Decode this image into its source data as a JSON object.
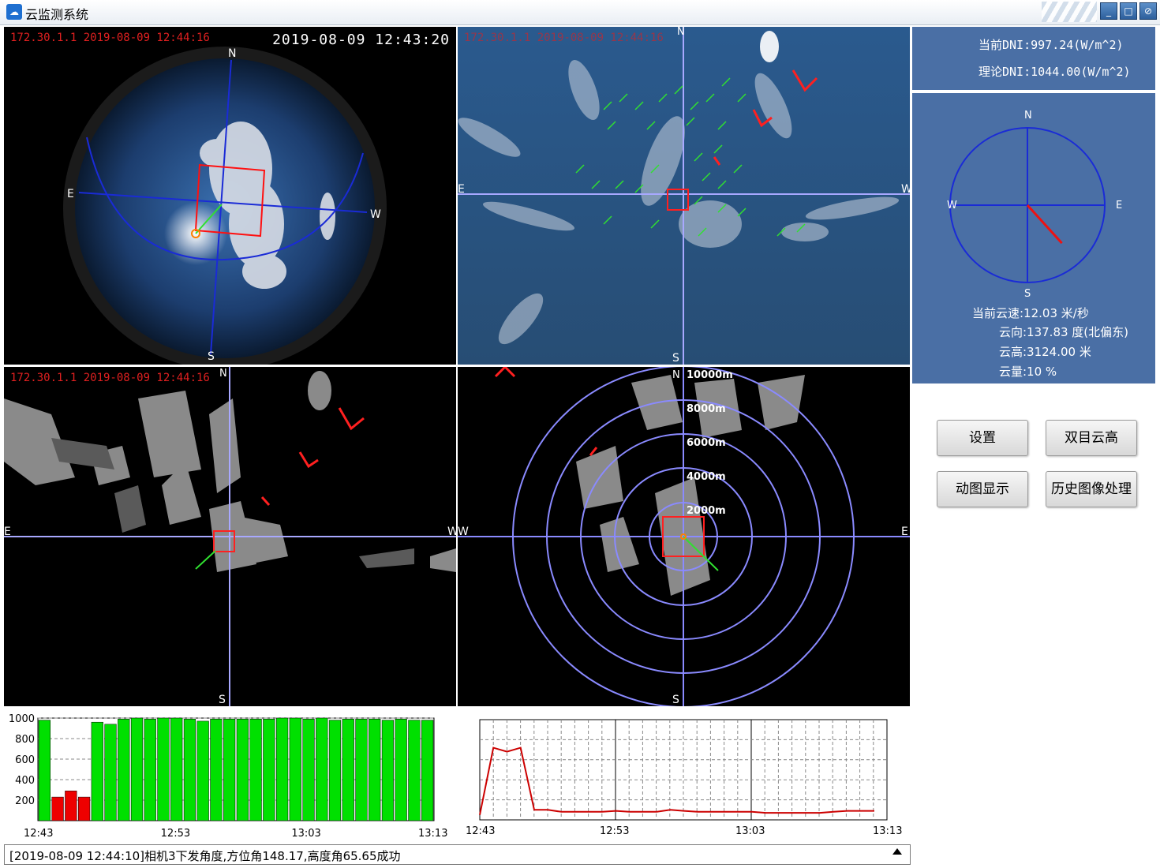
{
  "window": {
    "title": "云监测系统",
    "buttons": [
      "minimize",
      "maximize",
      "close"
    ]
  },
  "panels": {
    "fisheye": {
      "ip_time": "172.30.1.1 2019-08-09 12:44:16",
      "timestamp": "2019-08-09 12:43:20",
      "dirs": {
        "n": "N",
        "s": "S",
        "e": "E",
        "w": "W"
      }
    },
    "projection": {
      "ip_time": "172.30.1.1 2019-08-09 12:44:16",
      "dirs": {
        "n": "N",
        "s": "S",
        "e": "E",
        "w": "W"
      }
    },
    "binary": {
      "ip_time": "172.30.1.1 2019-08-09 12:44:16",
      "dirs": {
        "n": "N",
        "s": "S",
        "e": "E",
        "w": "W"
      }
    },
    "height_rings": {
      "dirs": {
        "n": "N",
        "s": "S",
        "w": "W",
        "e": "E"
      },
      "rings": [
        "10000m",
        "8000m",
        "6000m",
        "4000m",
        "2000m"
      ]
    }
  },
  "info": {
    "current_dni": "当前DNI:997.24(W/m^2)",
    "theory_dni": "理论DNI:1044.00(W/m^2)",
    "compass": {
      "n": "N",
      "s": "S",
      "e": "E",
      "w": "W"
    },
    "cloud_speed": "当前云速:12.03 米/秒",
    "cloud_dir": "云向:137.83 度(北偏东)",
    "cloud_height": "云高:3124.00 米",
    "cloud_amount": "云量:10 %",
    "direction_deg": 137.83
  },
  "buttons": {
    "settings": "设置",
    "binocular": "双目云高",
    "animation": "动图显示",
    "history": "历史图像处理"
  },
  "status": {
    "message": "[2019-08-09 12:44:10]相机3下发角度,方位角148.17,高度角65.65成功"
  },
  "colors": {
    "info_bg": "#4a6fa5",
    "bar_green": "#00e000",
    "bar_red": "#ee0000",
    "line_red": "#cc0000",
    "grid_blue": "#7f7fff"
  },
  "chart_data": [
    {
      "type": "bar",
      "ylim": [
        0,
        1000
      ],
      "yticks": [
        200,
        400,
        600,
        800,
        1000
      ],
      "xticks": [
        "12:43",
        "12:53",
        "13:03",
        "13:13"
      ],
      "values": [
        980,
        230,
        290,
        230,
        960,
        940,
        990,
        1000,
        990,
        1000,
        1000,
        990,
        970,
        990,
        990,
        990,
        990,
        990,
        1000,
        1000,
        990,
        1000,
        980,
        990,
        990,
        990,
        980,
        990,
        980,
        980
      ],
      "colors": [
        "green",
        "red",
        "red",
        "red",
        "green",
        "green",
        "green",
        "green",
        "green",
        "green",
        "green",
        "green",
        "green",
        "green",
        "green",
        "green",
        "green",
        "green",
        "green",
        "green",
        "green",
        "green",
        "green",
        "green",
        "green",
        "green",
        "green",
        "green",
        "green",
        "green"
      ]
    },
    {
      "type": "line",
      "xticks": [
        "12:43",
        "12:53",
        "13:03",
        "13:13"
      ],
      "ylim": [
        0,
        100
      ],
      "values": [
        5,
        72,
        68,
        72,
        10,
        10,
        8,
        8,
        8,
        8,
        9,
        8,
        8,
        8,
        10,
        9,
        8,
        8,
        8,
        8,
        8,
        7,
        7,
        7,
        7,
        7,
        8,
        9,
        9,
        9
      ]
    }
  ]
}
